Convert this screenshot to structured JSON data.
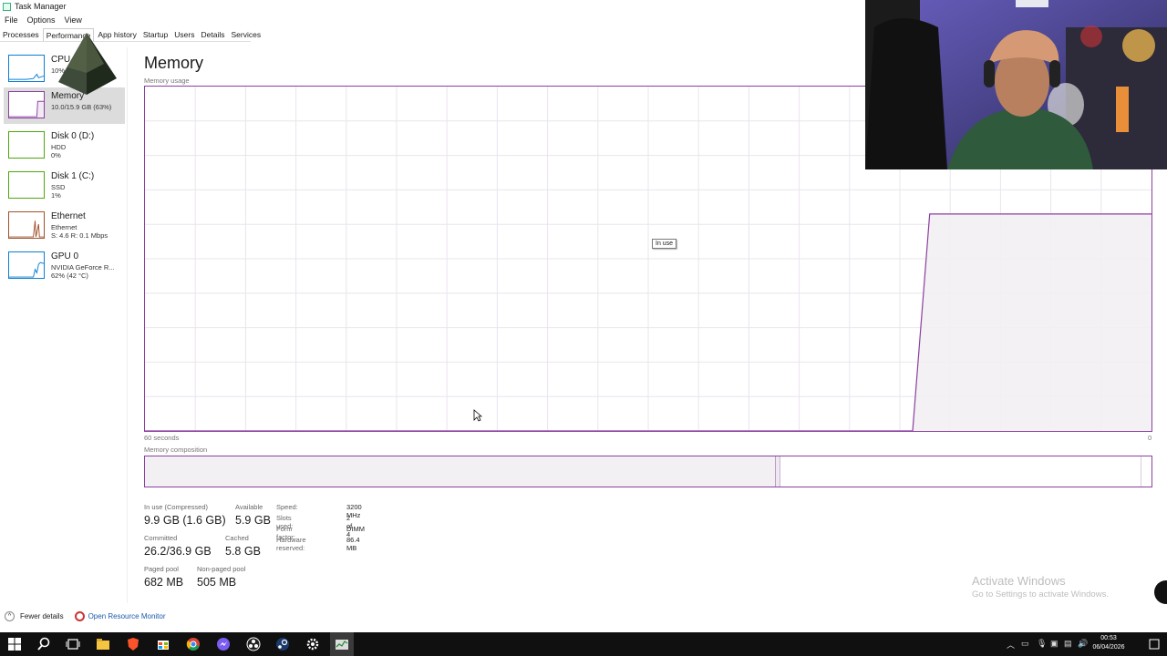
{
  "window": {
    "title": "Task Manager"
  },
  "menu": [
    "File",
    "Options",
    "View"
  ],
  "tabs": [
    "Processes",
    "Performance",
    "App history",
    "Startup",
    "Users",
    "Details",
    "Services"
  ],
  "sidebar": {
    "items": [
      {
        "name": "CPU",
        "sub1": "10%",
        "sub2": ""
      },
      {
        "name": "Memory",
        "sub1": "10.0/15.9 GB (63%)",
        "sub2": ""
      },
      {
        "name": "Disk 0 (D:)",
        "sub1": "HDD",
        "sub2": "0%"
      },
      {
        "name": "Disk 1 (C:)",
        "sub1": "SSD",
        "sub2": "1%"
      },
      {
        "name": "Ethernet",
        "sub1": "Ethernet",
        "sub2": "S: 4.6 R: 0.1 Mbps"
      },
      {
        "name": "GPU 0",
        "sub1": "NVIDIA GeForce R...",
        "sub2": "62% (42 °C)"
      }
    ]
  },
  "main": {
    "title": "Memory",
    "graph_label": "Memory usage",
    "tooltip": "In use",
    "axis_left": "60 seconds",
    "axis_right": "0",
    "composition_label": "Memory composition"
  },
  "stats": {
    "in_use": {
      "label": "In use (Compressed)",
      "value": "9.9 GB (1.6 GB)"
    },
    "available": {
      "label": "Available",
      "value": "5.9 GB"
    },
    "committed": {
      "label": "Committed",
      "value": "26.2/36.9 GB"
    },
    "cached": {
      "label": "Cached",
      "value": "5.8 GB"
    },
    "paged_pool": {
      "label": "Paged pool",
      "value": "682 MB"
    },
    "non_paged_pool": {
      "label": "Non-paged pool",
      "value": "505 MB"
    }
  },
  "specs": [
    {
      "key": "Speed:",
      "value": "3200 MHz"
    },
    {
      "key": "Slots used:",
      "value": "2 of 4"
    },
    {
      "key": "Form factor:",
      "value": "DIMM"
    },
    {
      "key": "Hardware reserved:",
      "value": "86.4 MB"
    }
  ],
  "footer": {
    "fewer_details": "Fewer details",
    "resource_monitor": "Open Resource Monitor"
  },
  "watermark": {
    "line1": "Activate Windows",
    "line2": "Go to Settings to activate Windows."
  },
  "taskbar": {
    "time": "00:53",
    "date": "06/04/2026"
  },
  "colors": {
    "memory_accent": "#8b3fa0",
    "memory_fill": "#f2f0f2",
    "cpu_accent": "#0b7fd0",
    "disk_accent": "#4da60c",
    "ethernet_accent": "#a0522d",
    "taskbar": "#101010"
  },
  "memory_usage_history_percent": [
    0,
    0,
    0,
    0,
    0,
    0,
    0,
    0,
    0,
    0,
    0,
    0,
    0,
    0,
    0,
    0,
    0,
    0,
    0,
    0,
    0,
    0,
    0,
    0,
    0,
    0,
    0,
    0,
    0,
    0,
    0,
    0,
    0,
    0,
    0,
    0,
    0,
    0,
    0,
    0,
    0,
    0,
    0,
    0,
    0,
    0,
    63,
    63,
    63,
    63,
    63,
    63,
    63,
    63,
    63,
    63,
    63,
    63,
    63,
    63
  ]
}
